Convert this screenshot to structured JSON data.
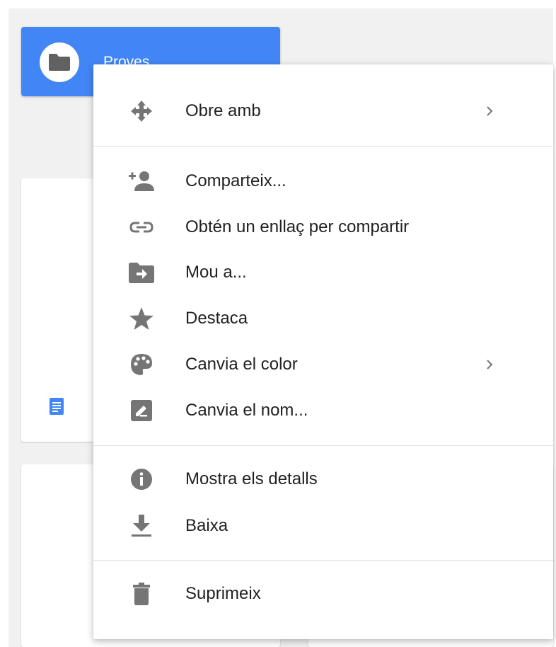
{
  "background": {
    "folder": {
      "name": "Proves",
      "color": "#4285f4"
    },
    "doc_icon_color": "#4285f4"
  },
  "menu": {
    "items": [
      {
        "label": "Obre amb",
        "icon": "move-arrows-icon",
        "submenu": true
      },
      {
        "label": "Comparteix...",
        "icon": "person-add-icon",
        "submenu": false
      },
      {
        "label": "Obtén un enllaç per compartir",
        "icon": "link-icon",
        "submenu": false
      },
      {
        "label": "Mou a...",
        "icon": "folder-move-icon",
        "submenu": false
      },
      {
        "label": "Destaca",
        "icon": "star-icon",
        "submenu": false
      },
      {
        "label": "Canvia el color",
        "icon": "palette-icon",
        "submenu": true
      },
      {
        "label": "Canvia el nom...",
        "icon": "rename-icon",
        "submenu": false
      },
      {
        "label": "Mostra els detalls",
        "icon": "info-icon",
        "submenu": false
      },
      {
        "label": "Baixa",
        "icon": "download-icon",
        "submenu": false
      },
      {
        "label": "Suprimeix",
        "icon": "trash-icon",
        "submenu": false
      }
    ],
    "submenu_glyph": ">",
    "icon_color": "#757575",
    "text_color": "#212121"
  }
}
